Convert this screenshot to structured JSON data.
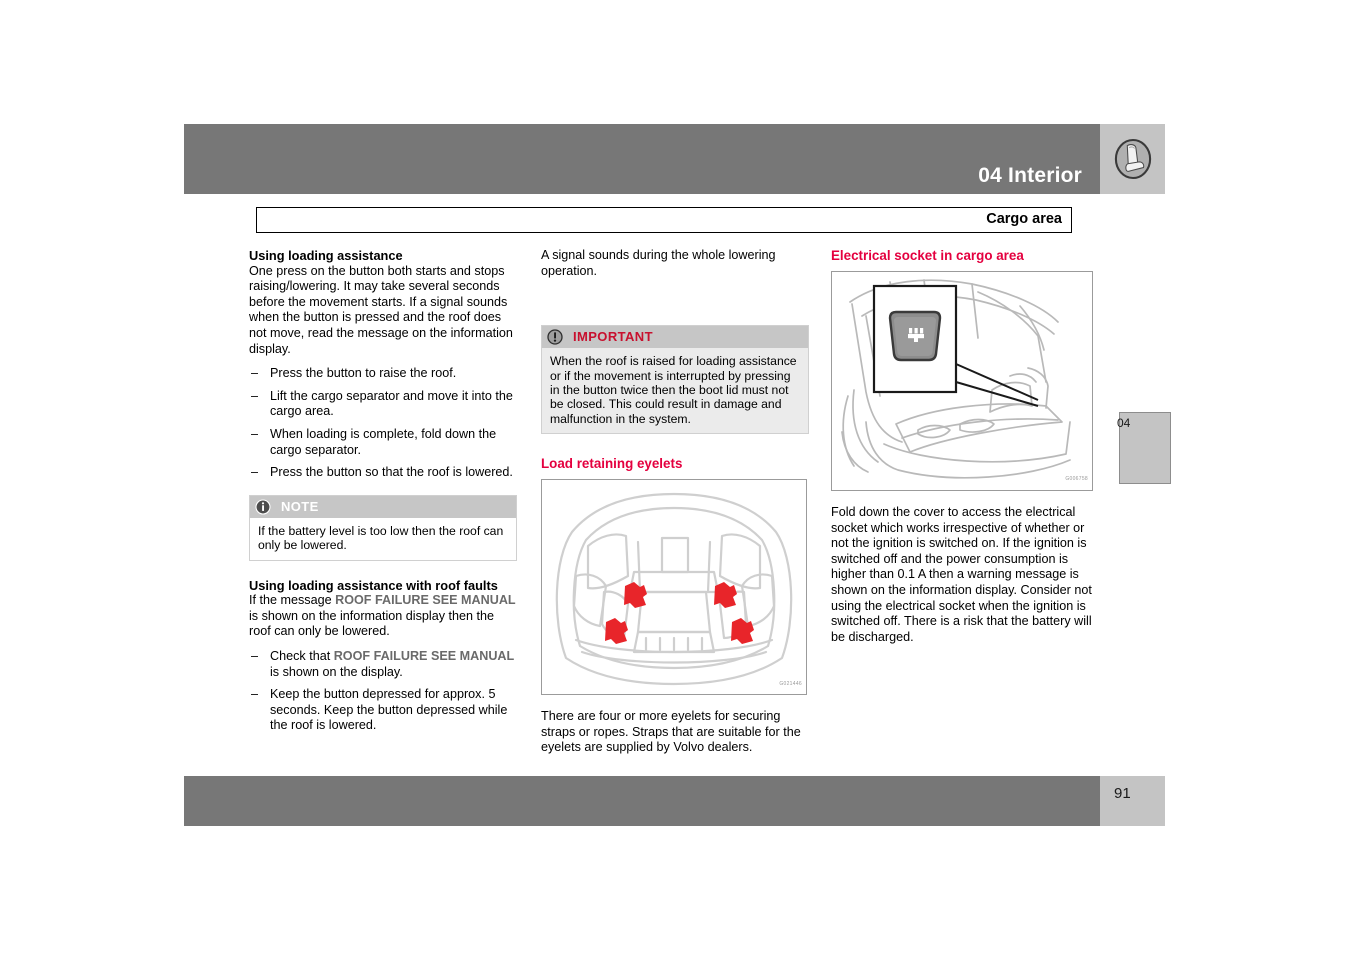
{
  "header": {
    "chapter_title": "04 Interior",
    "icon": "car-seat-icon",
    "bar_color": "#777777",
    "tab_color": "#c4c4c4"
  },
  "section": {
    "title": "Cargo area"
  },
  "side_tab": {
    "label": "04"
  },
  "footer": {
    "page_number": "91"
  },
  "columns": {
    "left": {
      "heading_1": "Using loading assistance",
      "paragraph_1": "One press on the button both starts and stops raising/lowering. It may take several seconds before the movement starts. If a signal sounds when the button is pressed and the roof does not move, read the message on the information display.",
      "list_1": [
        "Press the button to raise the roof.",
        "Lift the cargo separator and move it into the cargo area.",
        "When loading is complete, fold down the cargo separator.",
        "Press the button so that the roof is lowered."
      ],
      "note": {
        "icon": "info-circle-icon",
        "title": "NOTE",
        "body": "If the battery level is too low then the roof can only be lowered."
      },
      "heading_2": "Using loading assistance with roof faults",
      "paragraph_2_pre": "If the message ",
      "paragraph_2_msg": "ROOF FAILURE SEE MANUAL",
      "paragraph_2_post": " is shown on the information display then the roof can only be lowered.",
      "list_2_item_1_pre": "Check that ",
      "list_2_item_1_msg": "ROOF FAILURE SEE MANUAL",
      "list_2_item_1_post": " is shown on the display.",
      "list_2_item_2": "Keep the button depressed for approx. 5 seconds. Keep the button depressed while the roof is lowered."
    },
    "middle": {
      "paragraph_1": "A signal sounds during the whole lowering operation.",
      "important": {
        "icon": "exclamation-circle-icon",
        "title": "IMPORTANT",
        "title_color": "#c8102e",
        "body": "When the roof is raised for loading assistance or if the movement is interrupted by pressing in the button twice then the boot lid must not be closed. This could result in damage and malfunction in the system."
      },
      "heading_1": "Load retaining eyelets",
      "heading_color": "#e4003f",
      "figure": {
        "name": "cargo-area-eyelets-diagram",
        "eyelet_count": 4,
        "eyelet_color": "#e8252a",
        "code": "G021446"
      },
      "caption": "There are four or more eyelets for securing straps or ropes. Straps that are suitable for the eyelets are supplied by Volvo dealers."
    },
    "right": {
      "heading_1": "Electrical socket in cargo area",
      "heading_color": "#e4003f",
      "figure": {
        "name": "cargo-electrical-socket-diagram",
        "code": "G006758"
      },
      "paragraph_1": "Fold down the cover to access the electrical socket which works irrespective of whether or not the ignition is switched on. If the ignition is switched off and the power consumption is higher than 0.1 A then a warning message is shown on the information display. Consider not using the electrical socket when the ignition is switched off. There is a risk that the battery will be discharged."
    }
  }
}
